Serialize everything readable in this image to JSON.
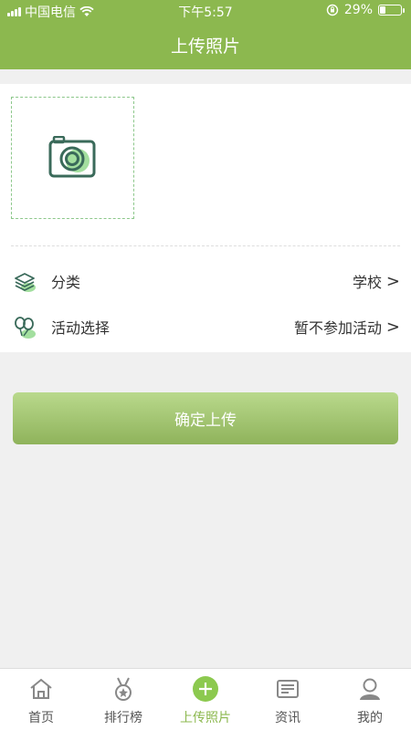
{
  "status_bar": {
    "carrier": "中国电信",
    "time": "下午5:57",
    "battery": "29%",
    "battery_level": 0.29
  },
  "header": {
    "title": "上传照片"
  },
  "form": {
    "photo_slot_icon": "camera-icon",
    "rows": [
      {
        "icon": "layers-icon",
        "label": "分类",
        "value": "学校",
        "chevron": ">"
      },
      {
        "icon": "balloons-icon",
        "label": "活动选择",
        "value": "暂不参加活动",
        "chevron": ">"
      }
    ]
  },
  "submit": {
    "label": "确定上传"
  },
  "tabbar": {
    "tabs": [
      {
        "label": "首页",
        "icon": "home-icon"
      },
      {
        "label": "排行榜",
        "icon": "medal-icon"
      },
      {
        "label": "上传照片",
        "icon": "plus-circle-icon",
        "active": true
      },
      {
        "label": "资讯",
        "icon": "news-icon"
      },
      {
        "label": "我的",
        "icon": "user-icon"
      }
    ]
  },
  "colors": {
    "brand": "#8cb84f",
    "accent_light": "#a3df9f",
    "icon_dark": "#3a6a5a"
  }
}
